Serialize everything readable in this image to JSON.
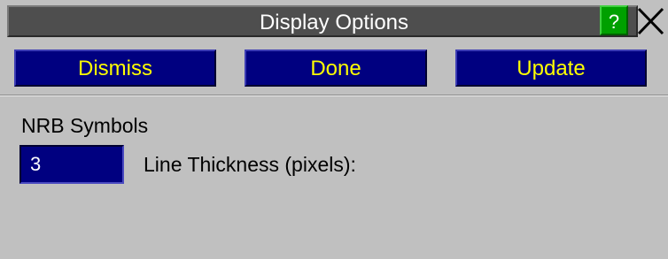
{
  "window": {
    "title": "Display Options"
  },
  "titlebar": {
    "help_label": "?",
    "close_icon": "close-x-icon"
  },
  "toolbar": {
    "dismiss_label": "Dismiss",
    "done_label": "Done",
    "update_label": "Update"
  },
  "section": {
    "title": "NRB Symbols"
  },
  "line_thickness": {
    "value": "3",
    "label": "Line Thickness (pixels):"
  },
  "colors": {
    "background": "#c0c0c0",
    "title_bar": "#4e4e4e",
    "button_bg": "#000080",
    "button_text": "#ffff00",
    "help_bg": "#00a000",
    "input_bg": "#000080",
    "input_text": "#ffffff"
  }
}
